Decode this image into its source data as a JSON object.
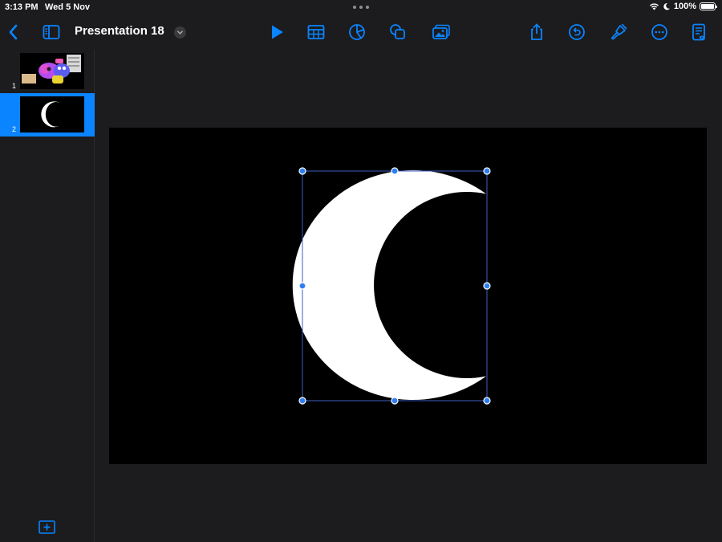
{
  "status": {
    "time": "3:13 PM",
    "date": "Wed 5 Nov",
    "battery": "100%",
    "battery_level": 1.0
  },
  "toolbar": {
    "back_icon": "chevron-left-icon",
    "sidebar_icon": "sidebar-toggle-icon",
    "title": "Presentation 18",
    "title_menu_icon": "chevron-down-icon",
    "play_icon": "play-icon",
    "table_icon": "table-icon",
    "chart_icon": "chart-icon",
    "shapes_icon": "shapes-icon",
    "media_icon": "media-icon",
    "share_icon": "share-icon",
    "undo_icon": "undo-icon",
    "format_icon": "paintbrush-icon",
    "more_icon": "more-icon",
    "presenter_notes_icon": "presenter-notes-icon"
  },
  "sidebar": {
    "slides": [
      {
        "number": "1",
        "selected": false,
        "thumbnail": "toy-animals-thumbnail"
      },
      {
        "number": "2",
        "selected": true,
        "thumbnail": "moon-thumbnail"
      }
    ],
    "add_slide_icon": "add-slide-icon"
  },
  "slide": {
    "background": "#000000",
    "shape": "crescent-moon",
    "shape_color": "#ffffff",
    "selection_color": "#2f7ef0"
  },
  "colors": {
    "accent": "#0a84ff",
    "background": "#1c1c1e"
  }
}
